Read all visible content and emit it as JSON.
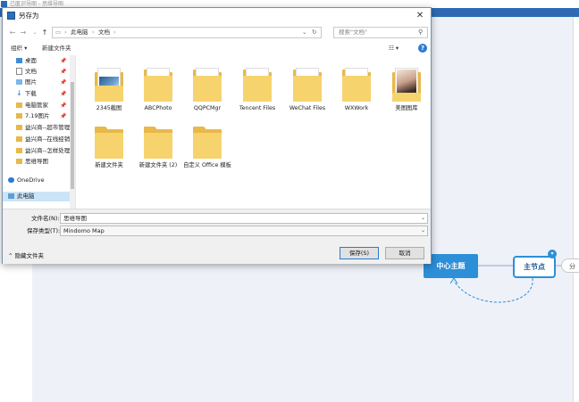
{
  "app": {
    "title": "已匿识导图 - 思维导图",
    "main_topic": "中心主题",
    "sub_topic": "主节点",
    "branch_label": "分",
    "badge": "▾"
  },
  "dialog": {
    "title": "另存为",
    "close_glyph": "✕",
    "address": {
      "path": [
        "此电脑",
        "文档"
      ],
      "sep": "›",
      "dropdown": "⌄",
      "refresh": "↻"
    },
    "search_placeholder": "搜索\"文档\"",
    "toolbar": {
      "organize": "组织 ▾",
      "new_folder": "新建文件夹",
      "view": "☷ ▾",
      "help": "?"
    },
    "nav_items": [
      {
        "label": "桌面",
        "icon": "desktop-icon",
        "pinned": true
      },
      {
        "label": "文档",
        "icon": "document-icon",
        "pinned": true
      },
      {
        "label": "图片",
        "icon": "picture-icon",
        "pinned": true
      },
      {
        "label": "下载",
        "icon": "download-icon",
        "pinned": true
      },
      {
        "label": "电脑管家",
        "icon": "folder-icon",
        "pinned": true
      },
      {
        "label": "7.19图片",
        "icon": "folder-icon",
        "pinned": true
      },
      {
        "label": "益兴商--超市管理",
        "icon": "folder-icon",
        "pinned": false
      },
      {
        "label": "益兴商--在线经销",
        "icon": "folder-icon",
        "pinned": false
      },
      {
        "label": "益兴商--怎样处理",
        "icon": "folder-icon",
        "pinned": false
      },
      {
        "label": "思维导图",
        "icon": "folder-icon",
        "pinned": false
      },
      {
        "label": "OneDrive",
        "icon": "onedrive-icon",
        "pinned": false
      },
      {
        "label": "此电脑",
        "icon": "computer-icon",
        "pinned": false
      }
    ],
    "files": [
      {
        "name": "2345截图",
        "kind": "photo-folder"
      },
      {
        "name": "ABCPhoto",
        "kind": "folder"
      },
      {
        "name": "QQPCMgr",
        "kind": "folder"
      },
      {
        "name": "Tencent Files",
        "kind": "folder"
      },
      {
        "name": "WeChat Files",
        "kind": "folder"
      },
      {
        "name": "WXWork",
        "kind": "folder"
      },
      {
        "name": "美图图库",
        "kind": "portrait-folder"
      },
      {
        "name": "新建文件夹",
        "kind": "folder"
      },
      {
        "name": "新建文件夹 (2)",
        "kind": "folder"
      },
      {
        "name": "自定义 Office 模板",
        "kind": "folder"
      }
    ],
    "filename_label": "文件名(N):",
    "filename_value": "思维导图",
    "filetype_label": "保存类型(T):",
    "filetype_value": "Mindomo Map",
    "hide_folders": "隐藏文件夹",
    "save_button": "保存(S)",
    "cancel_button": "取消"
  },
  "colors": {
    "accent": "#2c8fd8",
    "ribbon": "#2d6ab3",
    "folder": "#f6d36d"
  }
}
